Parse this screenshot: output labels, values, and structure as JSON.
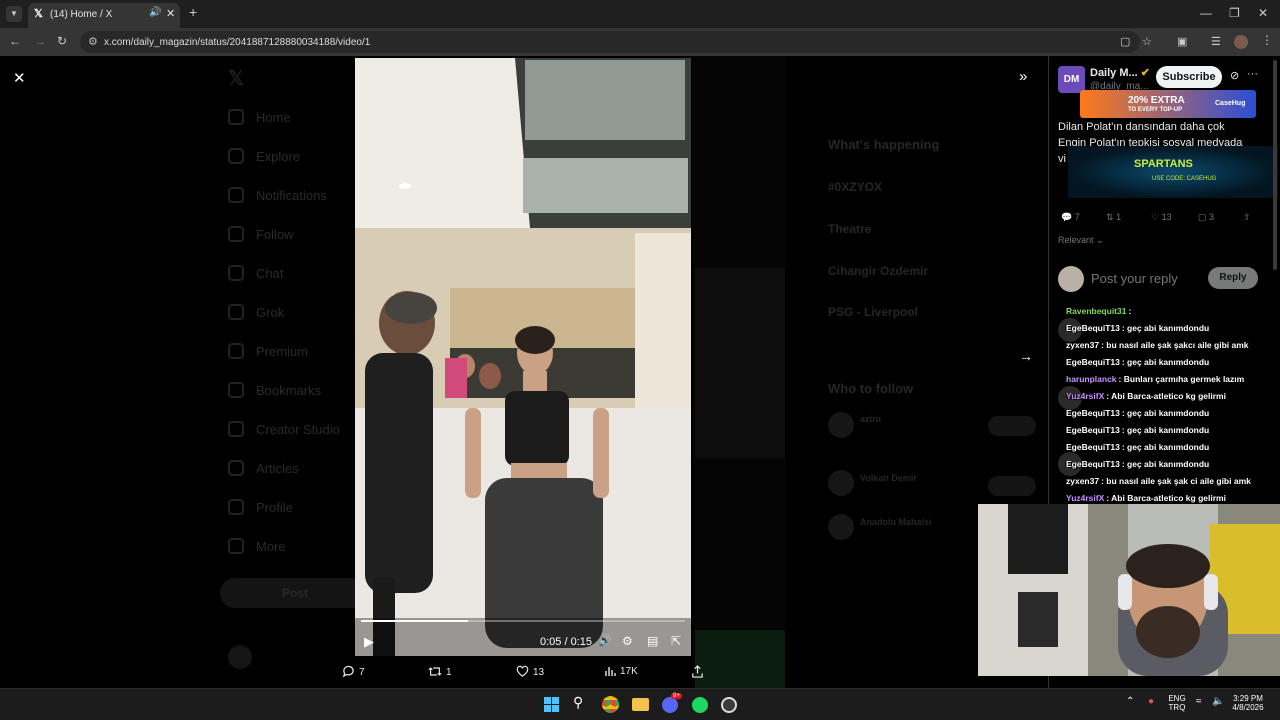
{
  "browser": {
    "tab_title": "(14) Home / X",
    "url": "x.com/daily_magazin/status/2041887128880034188/video/1"
  },
  "background_page": {
    "nav": [
      "Home",
      "Explore",
      "Notifications",
      "Follow",
      "Chat",
      "Grok",
      "Premium",
      "Bookmarks",
      "Creator Studio",
      "Articles",
      "Profile",
      "More"
    ],
    "post_button": "Post",
    "whats_happening": "What's happening",
    "trends": [
      "#0XZYOX",
      "Theatre",
      "Cihangir Ozdemir",
      "PSG - Liverpool"
    ],
    "who_to_follow": "Who to follow",
    "follow_names": [
      "aziru",
      "Volkan Demir",
      "Anadolu Mahalsi"
    ]
  },
  "video": {
    "time": "0:05 / 0:15",
    "progress": 0.33
  },
  "actions": {
    "replies": "7",
    "reposts": "1",
    "likes": "13",
    "views": "17K"
  },
  "post": {
    "author_name": "Daily M...",
    "handle": "@daily_ma...",
    "avatar_text": "DM",
    "subscribe_label": "Subscribe",
    "text_line1": "Dilan Polat'ın dansından daha çok",
    "text_line2": "Engin Polat'ın tepkisi sosyal medyada",
    "text_line3": "vi",
    "stats": {
      "replies": "7",
      "reposts": "1",
      "likes": "13",
      "bookmarks": "3"
    },
    "sort_label": "Relevant",
    "reply_placeholder": "Post your reply",
    "reply_button": "Reply"
  },
  "ad": {
    "headline": "20% EXTRA",
    "sub": "TO EVERY TOP-UP",
    "brand": "CaseHug",
    "sponsor": "SPARTANS",
    "code": "USE CODE: CASEHUG"
  },
  "chat": [
    {
      "user": "Ravenbequit31",
      "color": "#7ed957",
      "msg": ": "
    },
    {
      "user": "EgeBequiT13",
      "color": "#ffffff",
      "msg": ": geç abi kanımdondu"
    },
    {
      "user": "zyxen37",
      "color": "#ffffff",
      "msg": ": bu nasıl aile şak şakcı aile gibi amk"
    },
    {
      "user": "EgeBequiT13",
      "color": "#ffffff",
      "msg": ": geç abi kanımdondu"
    },
    {
      "user": "harunplanck",
      "color": "#c792ff",
      "msg": ": Bunları çarmıha germek lazım"
    },
    {
      "user": "Yuz4rsifX",
      "color": "#c792ff",
      "msg": ": Abi Barca-atletico kg gelirmi"
    },
    {
      "user": "EgeBequiT13",
      "color": "#ffffff",
      "msg": ": geç abi kanımdondu"
    },
    {
      "user": "EgeBequiT13",
      "color": "#ffffff",
      "msg": ": geç abi kanımdondu"
    },
    {
      "user": "EgeBequiT13",
      "color": "#ffffff",
      "msg": ": geç abi kanımdondu"
    },
    {
      "user": "EgeBequiT13",
      "color": "#ffffff",
      "msg": ": geç abi kanımdondu"
    },
    {
      "user": "zyxen37",
      "color": "#ffffff",
      "msg": ": bu nasıl aile şak şak ci aile gibi amk"
    },
    {
      "user": "Yuz4rsifX",
      "color": "#c792ff",
      "msg": ": Abi Barca-atletico kg gelirmi"
    }
  ],
  "taskbar": {
    "lang1": "ENG",
    "lang2": "TRQ",
    "time": "3:29 PM",
    "date": "4/8/2026",
    "discord_badge": "9+"
  }
}
